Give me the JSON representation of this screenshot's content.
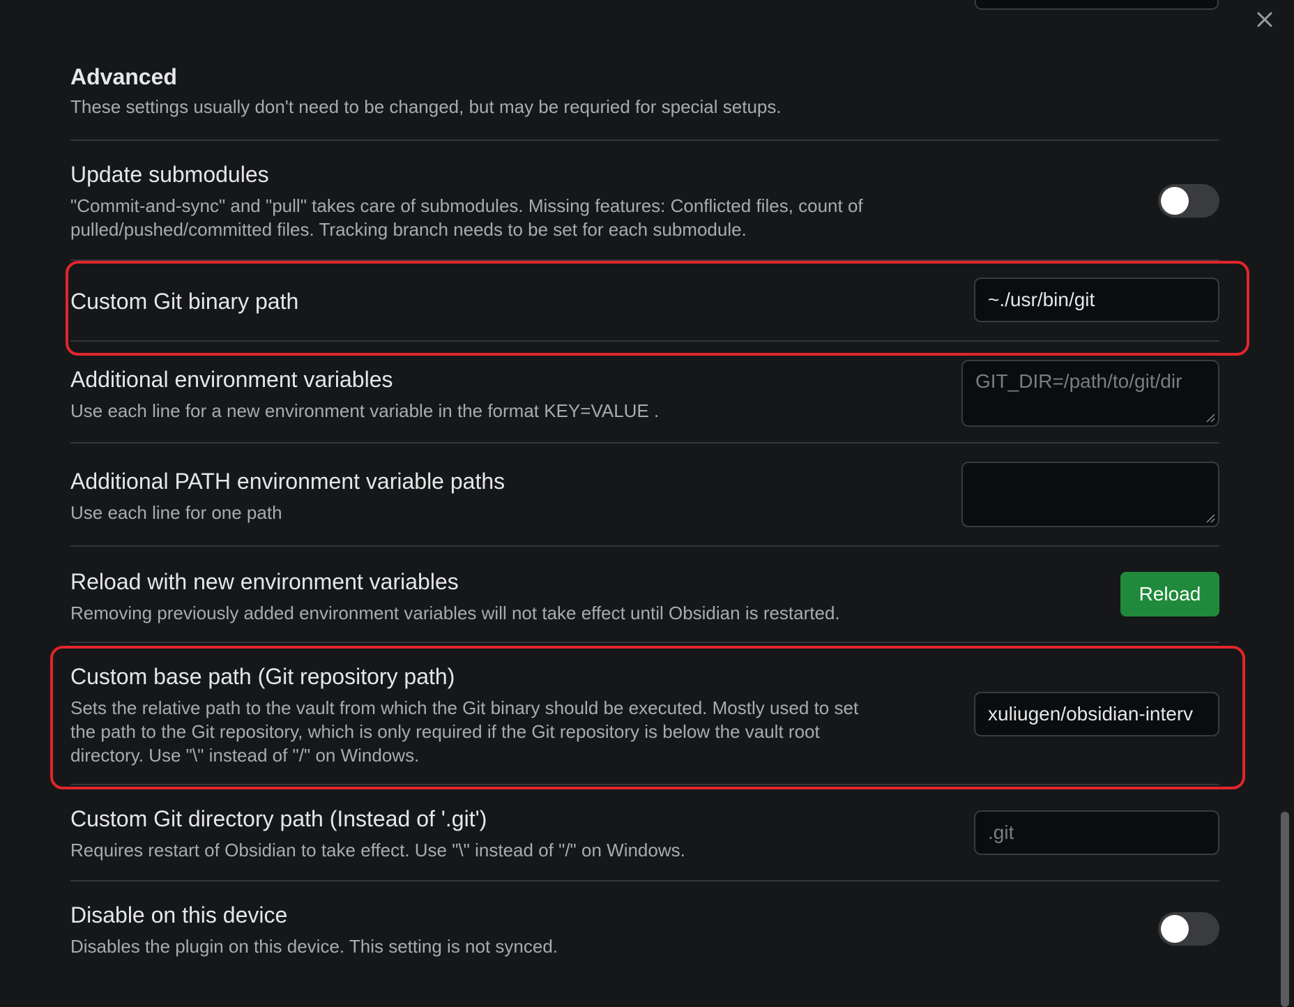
{
  "window": {
    "close_icon": "close-icon"
  },
  "advanced": {
    "title": "Advanced",
    "description": "These settings usually don't need to be changed, but may be requried for special setups."
  },
  "settings": {
    "update_submodules": {
      "name": "Update submodules",
      "description_line1": "\"Commit-and-sync\" and \"pull\" takes care of submodules. Missing features: Conflicted files, count of",
      "description_line2": "pulled/pushed/committed files. Tracking branch needs to be set for each submodule.",
      "enabled": false
    },
    "custom_git_binary_path": {
      "name": "Custom Git binary path",
      "value": "~./usr/bin/git"
    },
    "additional_env_vars": {
      "name": "Additional environment variables",
      "description": "Use each line for a new environment variable in the format KEY=VALUE .",
      "placeholder": "GIT_DIR=/path/to/git/dir"
    },
    "additional_path_vars": {
      "name": "Additional PATH environment variable paths",
      "description": "Use each line for one path",
      "placeholder": ""
    },
    "reload_env": {
      "name": "Reload with new environment variables",
      "description": "Removing previously added environment variables will not take effect until Obsidian is restarted.",
      "button_label": "Reload",
      "button_color": "#1f8a3b"
    },
    "custom_base_path": {
      "name": "Custom base path (Git repository path)",
      "description_line1": "Sets the relative path to the vault from which the Git binary should be executed. Mostly used to set",
      "description_line2": "the path to the Git repository, which is only required if the Git repository is below the vault root",
      "description_line3": "directory. Use \"\\\" instead of \"/\" on Windows.",
      "value": "xuliugen/obsidian-interv"
    },
    "custom_git_dir": {
      "name": "Custom Git directory path (Instead of '.git')",
      "description": "Requires restart of Obsidian to take effect. Use \"\\\" instead of \"/\" on Windows.",
      "placeholder": ".git"
    },
    "disable_device": {
      "name": "Disable on this device",
      "description": "Disables the plugin on this device. This setting is not synced.",
      "enabled": false
    }
  },
  "highlight_color": "#e0262b"
}
